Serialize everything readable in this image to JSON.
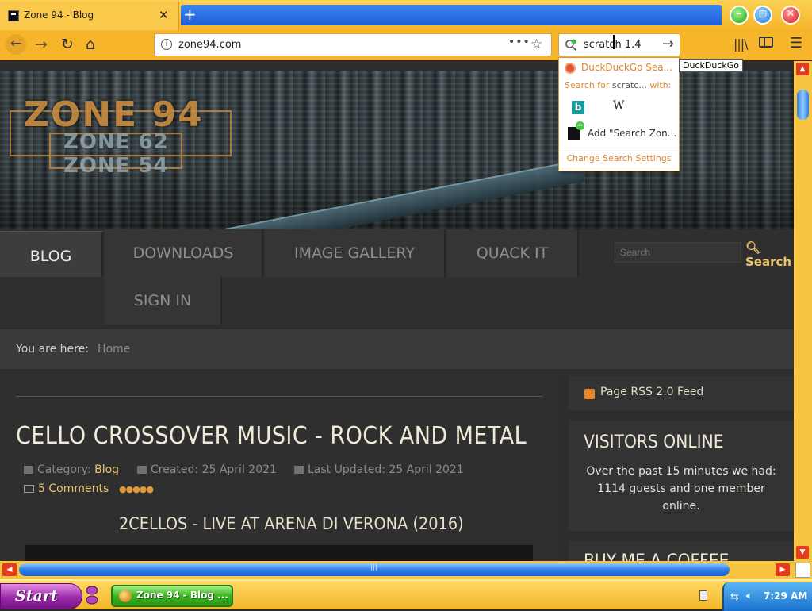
{
  "browser": {
    "tab_title": "Zone 94 - Blog",
    "tab_close": "✕",
    "new_tab": "+",
    "url": "zone94.com",
    "page_actions": "•••",
    "search_value": "scratch 1.4",
    "window_controls": {
      "minimize": "–",
      "restore": "◻",
      "close": "✕"
    }
  },
  "search_popup": {
    "ddg_label": "DuckDuckGo Sea...",
    "search_for_prefix": "Search for ",
    "search_for_term": "scratc...",
    "search_for_suffix": " with:",
    "bing_glyph": "b",
    "wiki_glyph": "W",
    "add_engine": "Add \"Search Zon...",
    "change_settings": "Change Search Settings",
    "tooltip": "DuckDuckGo"
  },
  "site": {
    "logo_main": "ZONE 94",
    "logo_sub1": "ZONE 62",
    "logo_sub2": "ZONE 54",
    "menu": {
      "blog": "BLOG",
      "downloads": "DOWNLOADS",
      "gallery": "IMAGE GALLERY",
      "quack": "QUACK IT",
      "signin": "SIGN IN"
    },
    "search_placeholder": "Search",
    "search_button": "Search",
    "breadcrumb": {
      "label": "You are here:",
      "home": "Home"
    }
  },
  "article": {
    "title": "CELLO CROSSOVER MUSIC - ROCK AND METAL",
    "category_label": "Category: ",
    "category_value": "Blog",
    "created": "Created: 25 April 2021",
    "updated": "Last Updated: 25 April 2021",
    "comments": "5 Comments",
    "rating": "●●●●●",
    "video_title": "2CELLOS - LIVE AT ARENA DI VERONA (2016)"
  },
  "sidebar": {
    "rss": "Page RSS 2.0 Feed",
    "visitors_title": "VISITORS ONLINE",
    "visitors_text": "Over the past 15 minutes we had: 1114 guests and one member online.",
    "coffee_title": "BUY ME A COFFEE"
  },
  "scrollbars": {
    "up": "▲",
    "down": "▼",
    "left": "◀",
    "right": "▶",
    "grip": "|||"
  },
  "taskbar": {
    "start": "Start",
    "task_label": "Zone 94 - Blog ...",
    "clock": "7:29 AM"
  }
}
